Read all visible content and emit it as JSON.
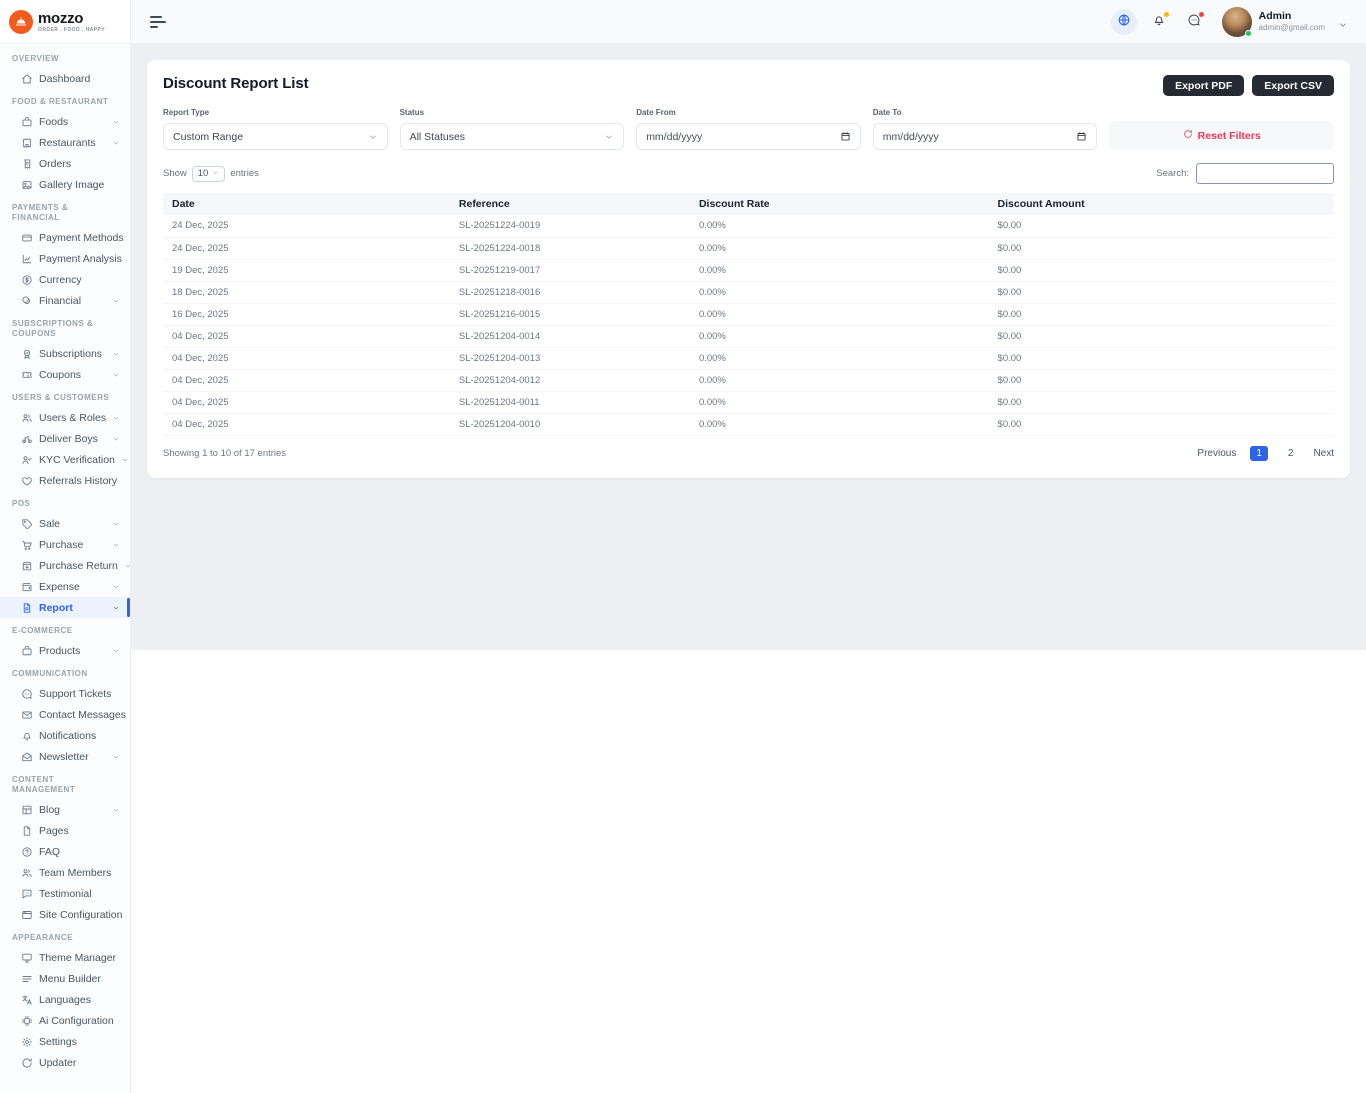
{
  "brand": {
    "name": "mozzo",
    "tagline": "ORDER . FOOD . HAPPY"
  },
  "topbar": {
    "user_name": "Admin",
    "user_email": "admin@gmail.com"
  },
  "sidebar": {
    "sections": [
      {
        "title": "OVERVIEW",
        "items": [
          {
            "label": "Dashboard",
            "icon": "home-icon"
          }
        ]
      },
      {
        "title": "FOOD & RESTAURANT",
        "items": [
          {
            "label": "Foods",
            "icon": "foods-icon",
            "expandable": true
          },
          {
            "label": "Restaurants",
            "icon": "restaurants-icon",
            "expandable": true
          },
          {
            "label": "Orders",
            "icon": "orders-icon"
          },
          {
            "label": "Gallery Image",
            "icon": "gallery-image-icon"
          }
        ]
      },
      {
        "title": "PAYMENTS & FINANCIAL",
        "items": [
          {
            "label": "Payment Methods",
            "icon": "payment-methods-icon"
          },
          {
            "label": "Payment Analysis",
            "icon": "payment-analysis-icon"
          },
          {
            "label": "Currency",
            "icon": "currency-icon"
          },
          {
            "label": "Financial",
            "icon": "financial-icon",
            "expandable": true
          }
        ]
      },
      {
        "title": "SUBSCRIPTIONS & COUPONS",
        "items": [
          {
            "label": "Subscriptions",
            "icon": "subscriptions-icon",
            "expandable": true
          },
          {
            "label": "Coupons",
            "icon": "coupons-icon",
            "expandable": true
          }
        ]
      },
      {
        "title": "USERS & CUSTOMERS",
        "items": [
          {
            "label": "Users & Roles",
            "icon": "users-roles-icon",
            "expandable": true
          },
          {
            "label": "Deliver Boys",
            "icon": "deliver-boys-icon",
            "expandable": true
          },
          {
            "label": "KYC Verification",
            "icon": "kyc-verification-icon",
            "expandable": true
          },
          {
            "label": "Referrals History",
            "icon": "referrals-history-icon"
          }
        ]
      },
      {
        "title": "POS",
        "items": [
          {
            "label": "Sale",
            "icon": "sale-icon",
            "expandable": true
          },
          {
            "label": "Purchase",
            "icon": "purchase-icon",
            "expandable": true
          },
          {
            "label": "Purchase Return",
            "icon": "purchase-return-icon",
            "expandable": true
          },
          {
            "label": "Expense",
            "icon": "expense-icon",
            "expandable": true
          },
          {
            "label": "Report",
            "icon": "report-icon",
            "expandable": true,
            "active": true
          }
        ]
      },
      {
        "title": "E-COMMERCE",
        "items": [
          {
            "label": "Products",
            "icon": "products-icon",
            "expandable": true
          }
        ]
      },
      {
        "title": "COMMUNICATION",
        "items": [
          {
            "label": "Support Tickets",
            "icon": "support-tickets-icon"
          },
          {
            "label": "Contact Messages",
            "icon": "contact-messages-icon"
          },
          {
            "label": "Notifications",
            "icon": "notifications-icon"
          },
          {
            "label": "Newsletter",
            "icon": "newsletter-icon",
            "expandable": true
          }
        ]
      },
      {
        "title": "CONTENT MANAGEMENT",
        "items": [
          {
            "label": "Blog",
            "icon": "blog-icon",
            "expandable": true
          },
          {
            "label": "Pages",
            "icon": "pages-icon"
          },
          {
            "label": "FAQ",
            "icon": "faq-icon"
          },
          {
            "label": "Team Members",
            "icon": "team-members-icon"
          },
          {
            "label": "Testimonial",
            "icon": "testimonial-icon"
          },
          {
            "label": "Site Configuration",
            "icon": "site-configuration-icon"
          }
        ]
      },
      {
        "title": "APPEARANCE",
        "items": [
          {
            "label": "Theme Manager",
            "icon": "theme-manager-icon"
          },
          {
            "label": "Menu Builder",
            "icon": "menu-builder-icon"
          },
          {
            "label": "Languages",
            "icon": "languages-icon"
          },
          {
            "label": "Ai Configuration",
            "icon": "ai-configuration-icon"
          },
          {
            "label": "Settings",
            "icon": "settings-icon"
          },
          {
            "label": "Updater",
            "icon": "updater-icon"
          }
        ]
      }
    ]
  },
  "page": {
    "title": "Discount Report List",
    "export_pdf_label": "Export PDF",
    "export_csv_label": "Export CSV",
    "filters": {
      "report_type_label": "Report Type",
      "report_type_value": "Custom Range",
      "status_label": "Status",
      "status_value": "All Statuses",
      "date_from_label": "Date From",
      "date_from_placeholder": "mm/dd/yyyy",
      "date_to_label": "Date To",
      "date_to_placeholder": "mm/dd/yyyy",
      "reset_label": "Reset Filters"
    },
    "list_controls": {
      "show_label": "Show",
      "page_size": "10",
      "entries_label": "entries",
      "search_label": "Search:",
      "search_value": ""
    },
    "table": {
      "columns": [
        "Date",
        "Reference",
        "Discount Rate",
        "Discount Amount"
      ],
      "rows": [
        {
          "date": "24 Dec, 2025",
          "reference": "SL-20251224-0019",
          "rate": "0.00%",
          "amount": "$0.00"
        },
        {
          "date": "24 Dec, 2025",
          "reference": "SL-20251224-0018",
          "rate": "0.00%",
          "amount": "$0.00"
        },
        {
          "date": "19 Dec, 2025",
          "reference": "SL-20251219-0017",
          "rate": "0.00%",
          "amount": "$0.00"
        },
        {
          "date": "18 Dec, 2025",
          "reference": "SL-20251218-0016",
          "rate": "0.00%",
          "amount": "$0.00"
        },
        {
          "date": "16 Dec, 2025",
          "reference": "SL-20251216-0015",
          "rate": "0.00%",
          "amount": "$0.00"
        },
        {
          "date": "04 Dec, 2025",
          "reference": "SL-20251204-0014",
          "rate": "0.00%",
          "amount": "$0.00"
        },
        {
          "date": "04 Dec, 2025",
          "reference": "SL-20251204-0013",
          "rate": "0.00%",
          "amount": "$0.00"
        },
        {
          "date": "04 Dec, 2025",
          "reference": "SL-20251204-0012",
          "rate": "0.00%",
          "amount": "$0.00"
        },
        {
          "date": "04 Dec, 2025",
          "reference": "SL-20251204-0011",
          "rate": "0.00%",
          "amount": "$0.00"
        },
        {
          "date": "04 Dec, 2025",
          "reference": "SL-20251204-0010",
          "rate": "0.00%",
          "amount": "$0.00"
        }
      ]
    },
    "footer": {
      "summary": "Showing 1 to 10 of 17 entries",
      "pagination": {
        "previous": "Previous",
        "next": "Next",
        "pages": [
          {
            "label": "1",
            "active": true
          },
          {
            "label": "2",
            "active": false
          }
        ]
      }
    }
  },
  "colors": {
    "accent": "#2e63e7",
    "brand_orange": "#f25b1e",
    "danger": "#ea3a5b",
    "dark_button": "#262b33",
    "content_background": "#edeff3",
    "status_online": "#22c55e",
    "badge_yellow": "#f6b51e",
    "badge_red": "#ee4444"
  }
}
